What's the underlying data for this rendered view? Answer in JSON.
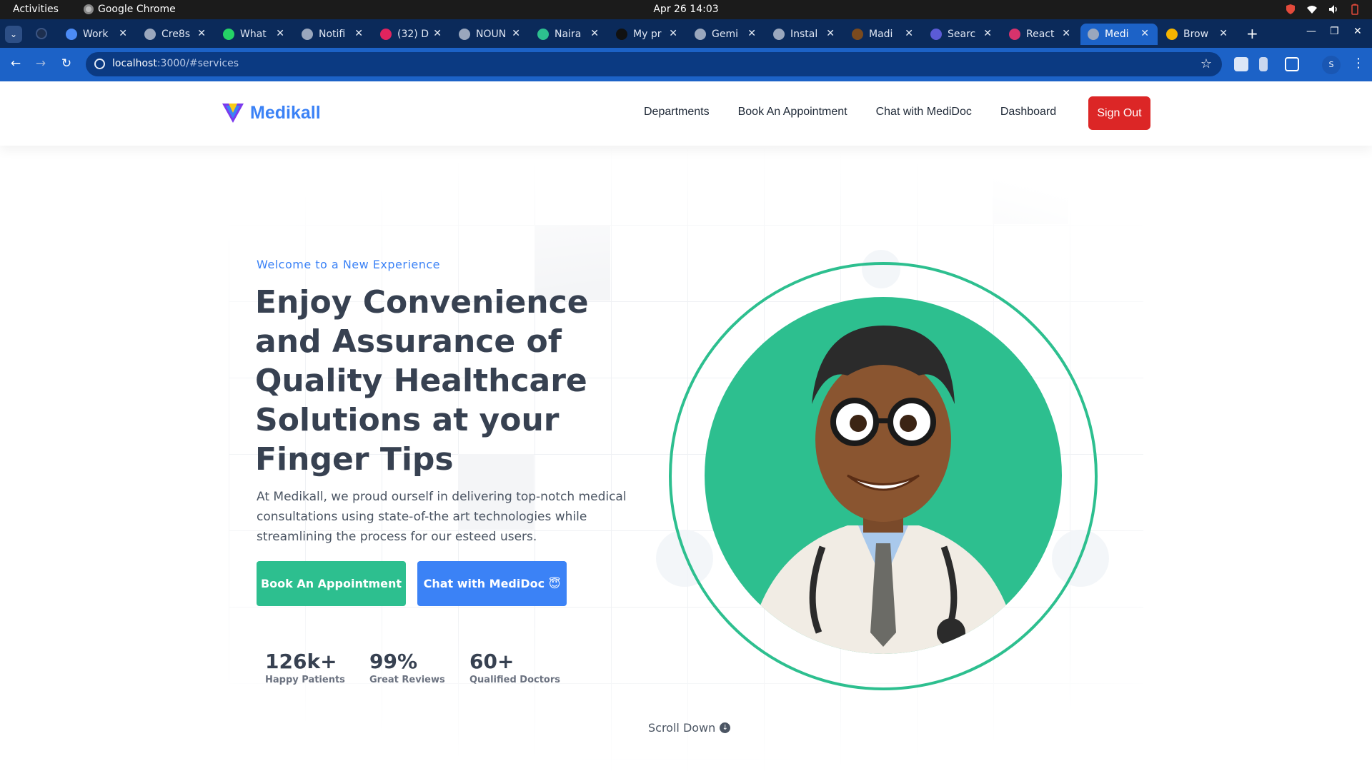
{
  "system_bar": {
    "activities": "Activities",
    "app_name": "Google Chrome",
    "clock": "Apr 26  14:03"
  },
  "browser": {
    "tabs": [
      {
        "title": "Work",
        "color": "#4c8bf5"
      },
      {
        "title": "Cre8s",
        "color": "#9aa7bd"
      },
      {
        "title": "What",
        "color": "#25d366"
      },
      {
        "title": "Notifi",
        "color": "#9aa7bd"
      },
      {
        "title": "(32) D",
        "color": "#e0245e"
      },
      {
        "title": "NOUN",
        "color": "#9aa7bd"
      },
      {
        "title": "Naira",
        "color": "#2dbf8f"
      },
      {
        "title": "My pr",
        "color": "#111111"
      },
      {
        "title": "Gemi",
        "color": "#9aa7bd"
      },
      {
        "title": "Instal",
        "color": "#9aa7bd"
      },
      {
        "title": "Madi",
        "color": "#7a4a1e"
      },
      {
        "title": "Searc",
        "color": "#5b5bd6"
      },
      {
        "title": "React",
        "color": "#d6336c"
      },
      {
        "title": "Medi",
        "color": "#9aa7bd"
      },
      {
        "title": "Brow",
        "color": "#f4b400"
      }
    ],
    "active_tab_index": 13,
    "url_host": "localhost",
    "url_path": ":3000/#services",
    "profile_initial": "S"
  },
  "site": {
    "brand": "Medikall",
    "brand_color": "#3b82f6",
    "accent_green": "#2dbf8f",
    "nav": [
      "Departments",
      "Book An Appointment",
      "Chat with MediDoc",
      "Dashboard"
    ],
    "sign_out": "Sign Out"
  },
  "hero": {
    "eyebrow": "Welcome to a New Experience",
    "headline": "Enjoy Convenience and Assurance of Quality Healthcare Solutions at your Finger Tips",
    "description": "At Medikall, we proud ourself in delivering top-notch medical consultations using state-of-the art technologies while streamlining the process for our esteed users.",
    "primary_cta": "Book An Appointment",
    "secondary_cta": "Chat with MediDoc 😇",
    "stats": [
      {
        "value": "126k+",
        "label": "Happy Patients"
      },
      {
        "value": "99%",
        "label": "Great Reviews"
      },
      {
        "value": "60+",
        "label": "Qualified Doctors"
      }
    ],
    "scroll_hint": "Scroll Down"
  }
}
